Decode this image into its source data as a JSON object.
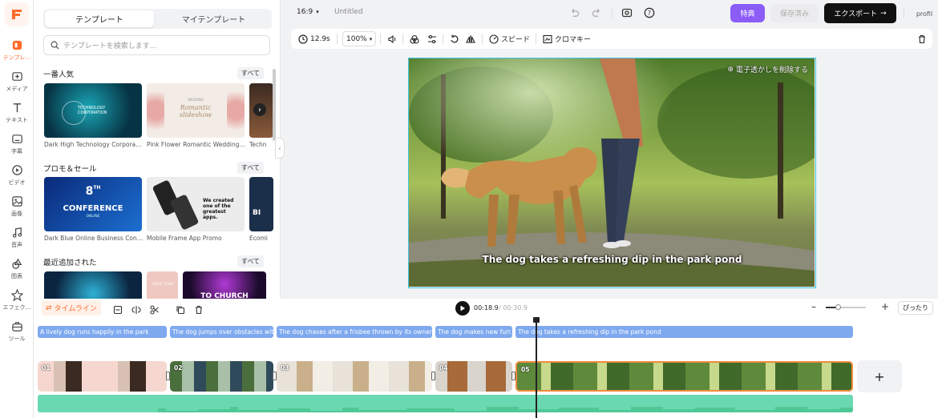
{
  "app": {
    "aspect": "16:9",
    "title": "Untitled"
  },
  "nav": [
    {
      "label": "テンプレ…",
      "icon": "template-icon"
    },
    {
      "label": "メディア",
      "icon": "media-icon"
    },
    {
      "label": "テキスト",
      "icon": "text-icon"
    },
    {
      "label": "字幕",
      "icon": "subtitle-icon"
    },
    {
      "label": "ビデオ",
      "icon": "video-icon"
    },
    {
      "label": "画像",
      "icon": "image-icon"
    },
    {
      "label": "音声",
      "icon": "audio-icon"
    },
    {
      "label": "图表",
      "icon": "shapes-icon"
    },
    {
      "label": "エフェク…",
      "icon": "effects-icon"
    },
    {
      "label": "ツール",
      "icon": "tools-icon"
    }
  ],
  "panel": {
    "tabs": [
      "テンプレート",
      "マイテンプレート"
    ],
    "search_placeholder": "テンプレートを検索します...",
    "all_label": "すべて",
    "sections": [
      {
        "title": "一番人気",
        "items": [
          "Dark High Technology Corporate ...",
          "Pink Flower Romantic Wedding ...",
          "Techn"
        ]
      },
      {
        "title": "プロモ＆セール",
        "items": [
          "Dark Blue Online Business Confe...",
          "Mobile Frame App Promo",
          "Ecomi"
        ]
      },
      {
        "title": "最近追加された",
        "items": []
      }
    ],
    "thumbs": {
      "tech_title": "TECHNOLOGY CORPORATION",
      "wedding_small": "WEDDING",
      "wedding_title": "Romantic slideshow",
      "conf_num": "8",
      "conf_sup": "TH",
      "conf_title": "CONFERENCE",
      "conf_sub": "ONLINE",
      "promo_text": "We created one of the greatest apps.",
      "third2_text": "BI",
      "sec3_thumb2": "VOCE TOUR",
      "sec3_thumb3": "TO CHURCH"
    }
  },
  "topbar": {
    "special": "特典",
    "saved": "保存済み",
    "export": "エクスポート",
    "profile": "profil"
  },
  "toolbar": {
    "duration": "12.9s",
    "zoom": "100%",
    "speed": "スピード",
    "chroma": "クロマキー"
  },
  "canvas": {
    "subtitle": "The dog takes a refreshing dip in the park pond",
    "watermark": "電子透かしを削除する"
  },
  "timeline": {
    "label": "タイムライン",
    "current": "00:18.9",
    "total": "/ 00:30.9",
    "fit": "ぴったり",
    "zoom_level": 0.3,
    "subtitles": [
      "A lively dog runs happily in the park",
      "The dog jumps over obstacles wit...",
      "The dog chases after a frisbee thrown by its owner",
      "The dog makes new furr...",
      "The dog takes a refreshing dip in the park pond"
    ],
    "clips": [
      "01",
      "02",
      "03",
      "04",
      "05"
    ],
    "add": "+"
  }
}
